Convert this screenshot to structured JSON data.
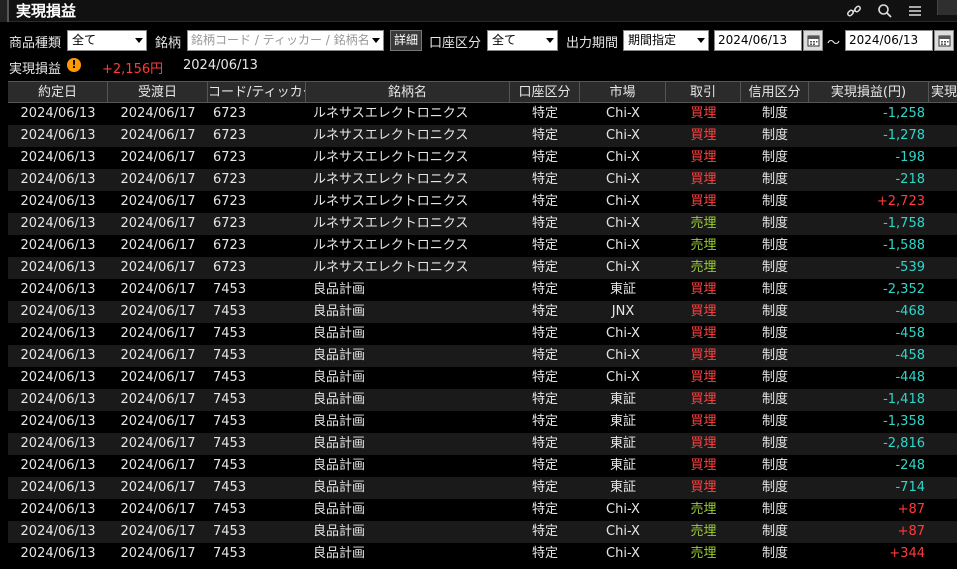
{
  "window": {
    "title": "実現損益",
    "icons": [
      "link-icon",
      "search-icon",
      "menu-icon",
      "close-icon"
    ]
  },
  "filters": {
    "product_label": "商品種類",
    "product_value": "全て",
    "symbol_label": "銘柄",
    "symbol_placeholder": "銘柄コード / ティッカー / 銘柄名",
    "detail_button": "詳細",
    "account_label": "口座区分",
    "account_value": "全て",
    "period_label": "出力期間",
    "period_value": "期間指定",
    "date_from": "2024/06/13",
    "range_sep": "～",
    "date_to": "2024/06/13"
  },
  "summary": {
    "label": "実現損益",
    "warning_icon": "!",
    "value": "+2,156円",
    "date": "2024/06/13"
  },
  "table": {
    "headers": [
      "約定日",
      "受渡日",
      "コード/ティッカー",
      "銘柄名",
      "口座区分",
      "市場",
      "取引",
      "信用区分",
      "実現損益(円)",
      "実現"
    ],
    "rows": [
      {
        "trade_date": "2024/06/13",
        "settle_date": "2024/06/17",
        "code": "6723",
        "name": "ルネサスエレクトロニクス",
        "account": "特定",
        "market": "Chi-X",
        "trade": "買埋",
        "margin": "制度",
        "pl": "-1,258"
      },
      {
        "trade_date": "2024/06/13",
        "settle_date": "2024/06/17",
        "code": "6723",
        "name": "ルネサスエレクトロニクス",
        "account": "特定",
        "market": "Chi-X",
        "trade": "買埋",
        "margin": "制度",
        "pl": "-1,278"
      },
      {
        "trade_date": "2024/06/13",
        "settle_date": "2024/06/17",
        "code": "6723",
        "name": "ルネサスエレクトロニクス",
        "account": "特定",
        "market": "Chi-X",
        "trade": "買埋",
        "margin": "制度",
        "pl": "-198"
      },
      {
        "trade_date": "2024/06/13",
        "settle_date": "2024/06/17",
        "code": "6723",
        "name": "ルネサスエレクトロニクス",
        "account": "特定",
        "market": "Chi-X",
        "trade": "買埋",
        "margin": "制度",
        "pl": "-218"
      },
      {
        "trade_date": "2024/06/13",
        "settle_date": "2024/06/17",
        "code": "6723",
        "name": "ルネサスエレクトロニクス",
        "account": "特定",
        "market": "Chi-X",
        "trade": "買埋",
        "margin": "制度",
        "pl": "+2,723"
      },
      {
        "trade_date": "2024/06/13",
        "settle_date": "2024/06/17",
        "code": "6723",
        "name": "ルネサスエレクトロニクス",
        "account": "特定",
        "market": "Chi-X",
        "trade": "売埋",
        "margin": "制度",
        "pl": "-1,758"
      },
      {
        "trade_date": "2024/06/13",
        "settle_date": "2024/06/17",
        "code": "6723",
        "name": "ルネサスエレクトロニクス",
        "account": "特定",
        "market": "Chi-X",
        "trade": "売埋",
        "margin": "制度",
        "pl": "-1,588"
      },
      {
        "trade_date": "2024/06/13",
        "settle_date": "2024/06/17",
        "code": "6723",
        "name": "ルネサスエレクトロニクス",
        "account": "特定",
        "market": "Chi-X",
        "trade": "売埋",
        "margin": "制度",
        "pl": "-539"
      },
      {
        "trade_date": "2024/06/13",
        "settle_date": "2024/06/17",
        "code": "7453",
        "name": "良品計画",
        "account": "特定",
        "market": "東証",
        "trade": "買埋",
        "margin": "制度",
        "pl": "-2,352"
      },
      {
        "trade_date": "2024/06/13",
        "settle_date": "2024/06/17",
        "code": "7453",
        "name": "良品計画",
        "account": "特定",
        "market": "JNX",
        "trade": "買埋",
        "margin": "制度",
        "pl": "-468"
      },
      {
        "trade_date": "2024/06/13",
        "settle_date": "2024/06/17",
        "code": "7453",
        "name": "良品計画",
        "account": "特定",
        "market": "Chi-X",
        "trade": "買埋",
        "margin": "制度",
        "pl": "-458"
      },
      {
        "trade_date": "2024/06/13",
        "settle_date": "2024/06/17",
        "code": "7453",
        "name": "良品計画",
        "account": "特定",
        "market": "Chi-X",
        "trade": "買埋",
        "margin": "制度",
        "pl": "-458"
      },
      {
        "trade_date": "2024/06/13",
        "settle_date": "2024/06/17",
        "code": "7453",
        "name": "良品計画",
        "account": "特定",
        "market": "Chi-X",
        "trade": "買埋",
        "margin": "制度",
        "pl": "-448"
      },
      {
        "trade_date": "2024/06/13",
        "settle_date": "2024/06/17",
        "code": "7453",
        "name": "良品計画",
        "account": "特定",
        "market": "東証",
        "trade": "買埋",
        "margin": "制度",
        "pl": "-1,418"
      },
      {
        "trade_date": "2024/06/13",
        "settle_date": "2024/06/17",
        "code": "7453",
        "name": "良品計画",
        "account": "特定",
        "market": "東証",
        "trade": "買埋",
        "margin": "制度",
        "pl": "-1,358"
      },
      {
        "trade_date": "2024/06/13",
        "settle_date": "2024/06/17",
        "code": "7453",
        "name": "良品計画",
        "account": "特定",
        "market": "東証",
        "trade": "買埋",
        "margin": "制度",
        "pl": "-2,816"
      },
      {
        "trade_date": "2024/06/13",
        "settle_date": "2024/06/17",
        "code": "7453",
        "name": "良品計画",
        "account": "特定",
        "market": "東証",
        "trade": "買埋",
        "margin": "制度",
        "pl": "-248"
      },
      {
        "trade_date": "2024/06/13",
        "settle_date": "2024/06/17",
        "code": "7453",
        "name": "良品計画",
        "account": "特定",
        "market": "東証",
        "trade": "買埋",
        "margin": "制度",
        "pl": "-714"
      },
      {
        "trade_date": "2024/06/13",
        "settle_date": "2024/06/17",
        "code": "7453",
        "name": "良品計画",
        "account": "特定",
        "market": "Chi-X",
        "trade": "売埋",
        "margin": "制度",
        "pl": "+87"
      },
      {
        "trade_date": "2024/06/13",
        "settle_date": "2024/06/17",
        "code": "7453",
        "name": "良品計画",
        "account": "特定",
        "market": "Chi-X",
        "trade": "売埋",
        "margin": "制度",
        "pl": "+87"
      },
      {
        "trade_date": "2024/06/13",
        "settle_date": "2024/06/17",
        "code": "7453",
        "name": "良品計画",
        "account": "特定",
        "market": "Chi-X",
        "trade": "売埋",
        "margin": "制度",
        "pl": "+344"
      }
    ]
  },
  "colors": {
    "buy": "#ff4040",
    "sell": "#9acd32",
    "loss": "#2ed6c8",
    "profit": "#ff3b3b",
    "warning": "#ff9a00"
  }
}
